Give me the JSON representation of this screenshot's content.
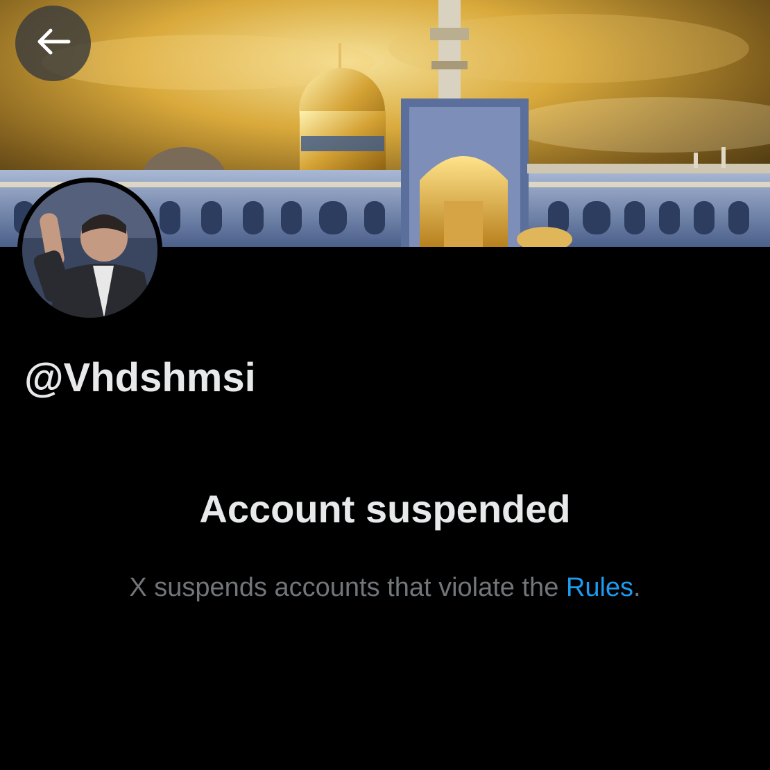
{
  "header": {
    "back_icon": "arrow-left-icon",
    "banner_image": "shrine-banner"
  },
  "profile": {
    "handle": "@Vhdshmsi",
    "avatar": "profile-avatar"
  },
  "notice": {
    "title": "Account suspended",
    "description_prefix": "X suspends accounts that violate the ",
    "link_label": "Rules",
    "description_suffix": "."
  },
  "colors": {
    "background": "#000000",
    "primary_text": "#e7e9ea",
    "secondary_text": "#71767b",
    "link": "#1d9bf0"
  }
}
